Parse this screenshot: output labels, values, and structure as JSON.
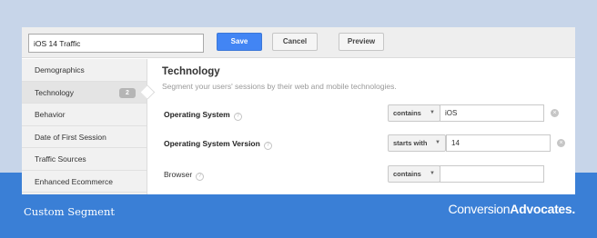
{
  "toolbar": {
    "segment_name": "iOS 14 Traffic",
    "save_label": "Save",
    "cancel_label": "Cancel",
    "preview_label": "Preview"
  },
  "sidebar": {
    "items": [
      {
        "label": "Demographics"
      },
      {
        "label": "Technology",
        "badge": "2"
      },
      {
        "label": "Behavior"
      },
      {
        "label": "Date of First Session"
      },
      {
        "label": "Traffic Sources"
      },
      {
        "label": "Enhanced Ecommerce"
      }
    ]
  },
  "main": {
    "title": "Technology",
    "subtitle": "Segment your users' sessions by their web and mobile technologies.",
    "rows": [
      {
        "label": "Operating System",
        "operator": "contains",
        "value": "iOS"
      },
      {
        "label": "Operating System Version",
        "operator": "starts with",
        "value": "14"
      },
      {
        "label": "Browser",
        "operator": "contains",
        "value": ""
      }
    ]
  },
  "icons": {
    "help": "?",
    "clear": "×",
    "caret": "▼"
  },
  "footer": {
    "caption": "Custom Segment",
    "brand_regular": "Conversion",
    "brand_bold": "Advocates."
  },
  "colors": {
    "accent": "#4285f4",
    "footer_bg": "#3a7fd6",
    "background": "#c7d5e9"
  }
}
